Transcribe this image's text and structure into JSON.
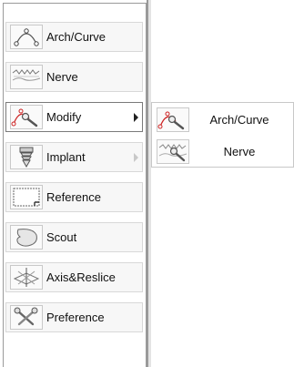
{
  "menu": {
    "items": [
      {
        "label": "Arch/Curve",
        "icon": "arch-curve-icon"
      },
      {
        "label": "Nerve",
        "icon": "nerve-icon"
      },
      {
        "label": "Modify",
        "icon": "modify-icon",
        "has_submenu": true,
        "active": true
      },
      {
        "label": "Implant",
        "icon": "implant-icon",
        "has_submenu": true,
        "submenu_enabled": false
      },
      {
        "label": "Reference",
        "icon": "reference-icon"
      },
      {
        "label": "Scout",
        "icon": "scout-icon"
      },
      {
        "label": "Axis&Reslice",
        "icon": "axis-reslice-icon"
      },
      {
        "label": "Preference",
        "icon": "preference-icon"
      }
    ]
  },
  "submenu": {
    "items": [
      {
        "label": "Arch/Curve",
        "icon": "modify-arch-curve-icon"
      },
      {
        "label": "Nerve",
        "icon": "modify-nerve-icon"
      }
    ]
  },
  "colors": {
    "accent_red": "#cc2222",
    "border": "#9a9a9a"
  }
}
